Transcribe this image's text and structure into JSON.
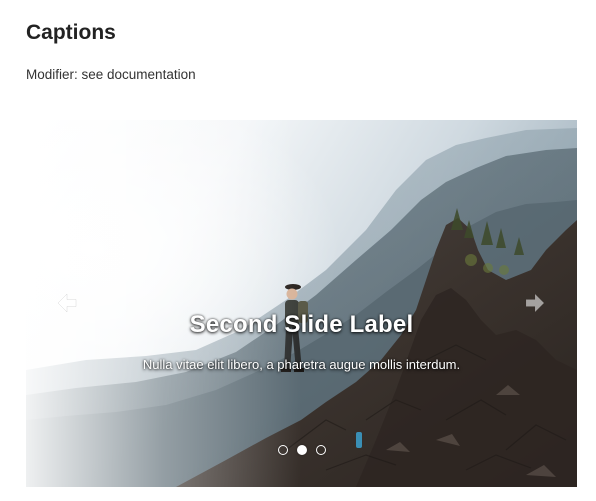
{
  "section": {
    "heading": "Captions",
    "modifier_text": "Modifier: see documentation"
  },
  "carousel": {
    "caption": {
      "title": "Second Slide Label",
      "text": "Nulla vitae elit libero, a pharetra augue mollis interdum."
    },
    "controls": {
      "prev_icon": "arrow-left-icon",
      "next_icon": "arrow-right-icon"
    },
    "indicators": {
      "count": 3,
      "active_index": 1
    },
    "image": "hiker-on-mountain-ridge-photo"
  },
  "colors": {
    "text_primary": "#222222",
    "caption_text": "#ffffff",
    "indicator": "#ffffff"
  }
}
